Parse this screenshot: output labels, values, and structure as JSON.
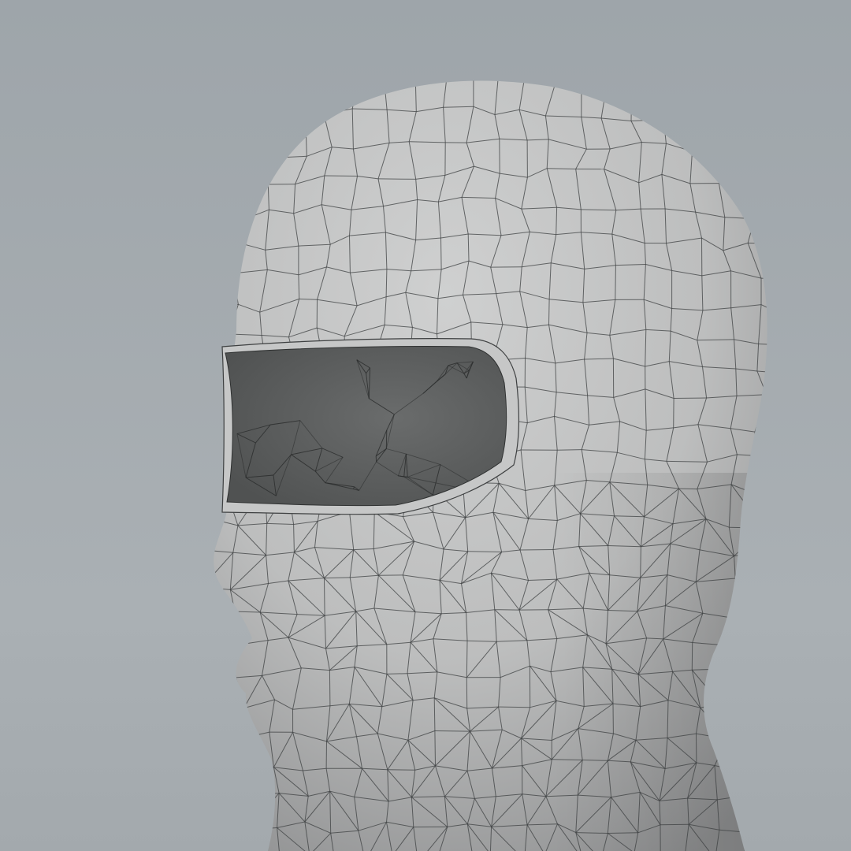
{
  "scene": {
    "subject": "balaclava-head-wireframe",
    "colors": {
      "background_top": "#9ea5aa",
      "background_mid": "#aab0b4",
      "background_bottom": "#a3a9ad",
      "surface_light": "#cfd0d0",
      "surface_mid": "#bdbebe",
      "surface_shadow": "#8d8e8f",
      "opening_dark": "#505252",
      "opening_mid": "#6a6c6c",
      "rim": "#c6c7c7",
      "wire": "#3e4041"
    }
  }
}
